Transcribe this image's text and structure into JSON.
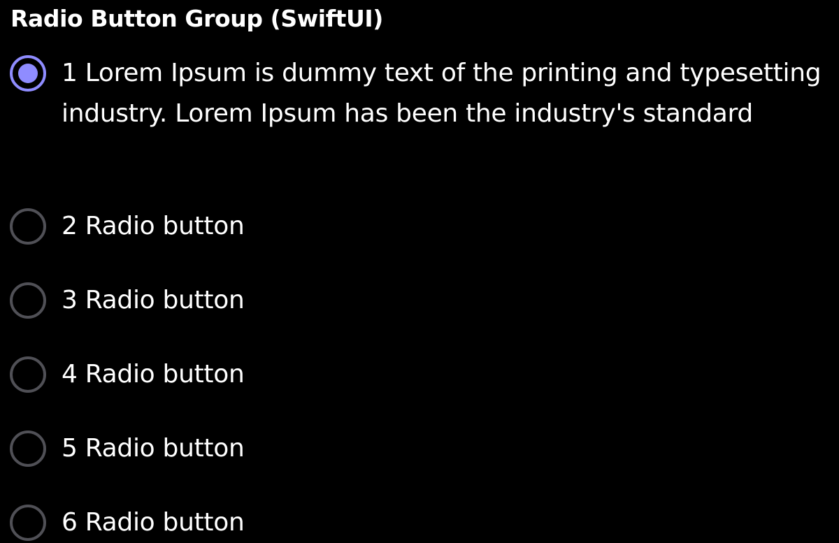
{
  "header": {
    "title": "Radio Button Group (SwiftUI)"
  },
  "radio_group": {
    "selected_index": 0,
    "options": [
      {
        "label": "1 Lorem Ipsum is dummy text of the printing and typesetting industry. Lorem Ipsum has been the industry's standard",
        "selected": true
      },
      {
        "label": "2 Radio button",
        "selected": false
      },
      {
        "label": "3 Radio button",
        "selected": false
      },
      {
        "label": "4 Radio button",
        "selected": false
      },
      {
        "label": "5 Radio button",
        "selected": false
      },
      {
        "label": "6 Radio button",
        "selected": false
      }
    ]
  },
  "colors": {
    "background": "#000000",
    "text": "#ffffff",
    "accent": "#8f8cff",
    "unselected_ring": "#505056"
  }
}
